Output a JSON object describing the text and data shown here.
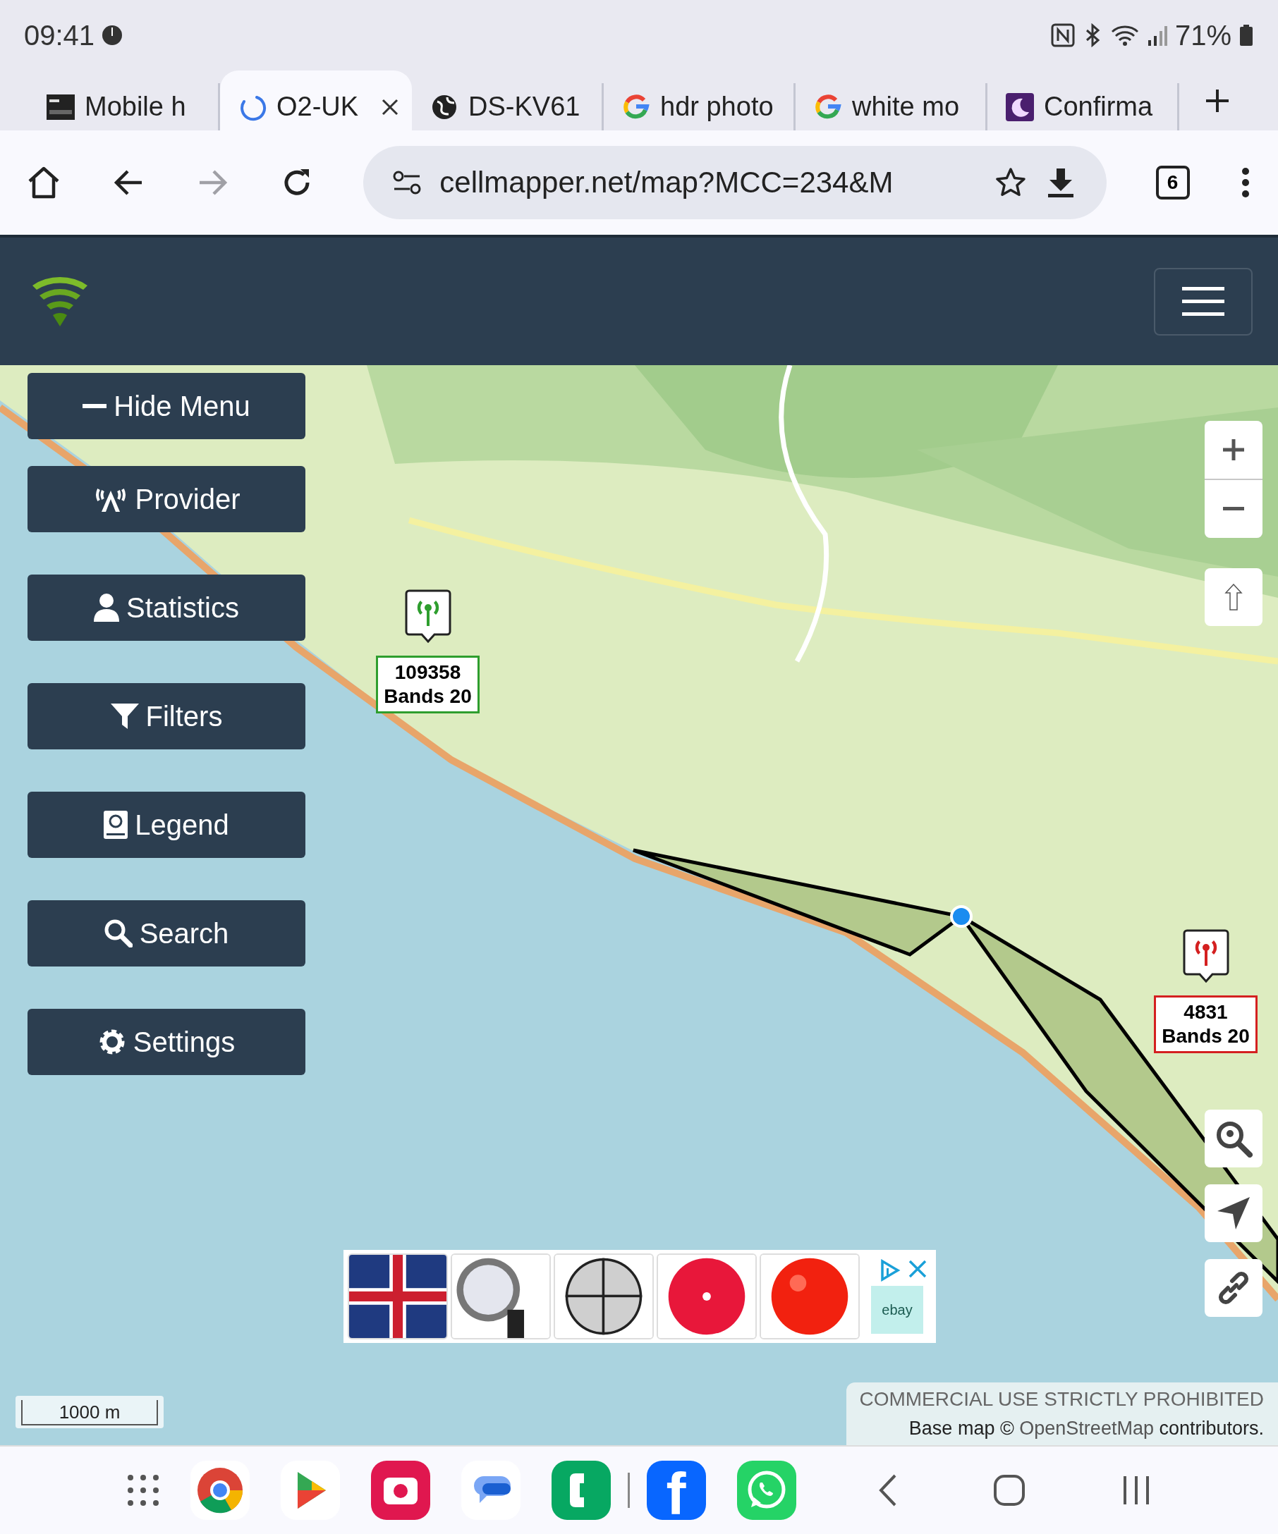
{
  "status_bar": {
    "time": "09:41",
    "battery": "71%"
  },
  "tabs": [
    {
      "title": "Mobile h",
      "kind": "thumb",
      "selected": false
    },
    {
      "title": "O2-UK",
      "kind": "loading",
      "selected": true
    },
    {
      "title": "DS-KV61",
      "kind": "globe",
      "selected": false
    },
    {
      "title": "hdr photo",
      "kind": "ring",
      "selected": false
    },
    {
      "title": "white mo",
      "kind": "ring",
      "selected": false
    },
    {
      "title": "Confirma",
      "kind": "moon",
      "selected": false
    }
  ],
  "toolbar": {
    "url": "cellmapper.net/map?MCC=234&M",
    "tab_count": "6",
    "forward_disabled": true
  },
  "menu": [
    {
      "label": "Hide Menu",
      "kind": "minus"
    },
    {
      "label": "Provider",
      "kind": "antenna"
    },
    {
      "label": "Statistics",
      "kind": "person"
    },
    {
      "label": "Filters",
      "kind": "funnel"
    },
    {
      "label": "Legend",
      "kind": "book"
    },
    {
      "label": "Search",
      "kind": "search"
    },
    {
      "label": "Settings",
      "kind": "gear"
    }
  ],
  "markers": [
    {
      "id": "109358",
      "bands": "Bands 20",
      "color": "#2e9e2e"
    },
    {
      "id": "4831",
      "bands": "Bands 20",
      "color": "#d42020"
    }
  ],
  "ad": {
    "logo": "ebay"
  },
  "scale": "1000 m",
  "attribution": {
    "notice": "COMMERCIAL USE STRICTLY PROHIBITED",
    "prefix": "Base map © ",
    "link": "OpenStreetMap",
    "suffix": " contributors."
  },
  "dock": [
    {
      "kind": "wheel"
    },
    {
      "kind": "play"
    },
    {
      "kind": "camera"
    },
    {
      "kind": "chat"
    },
    {
      "kind": "phone"
    },
    {
      "kind": "letter",
      "label": "f"
    },
    {
      "kind": "call-bubble"
    }
  ]
}
